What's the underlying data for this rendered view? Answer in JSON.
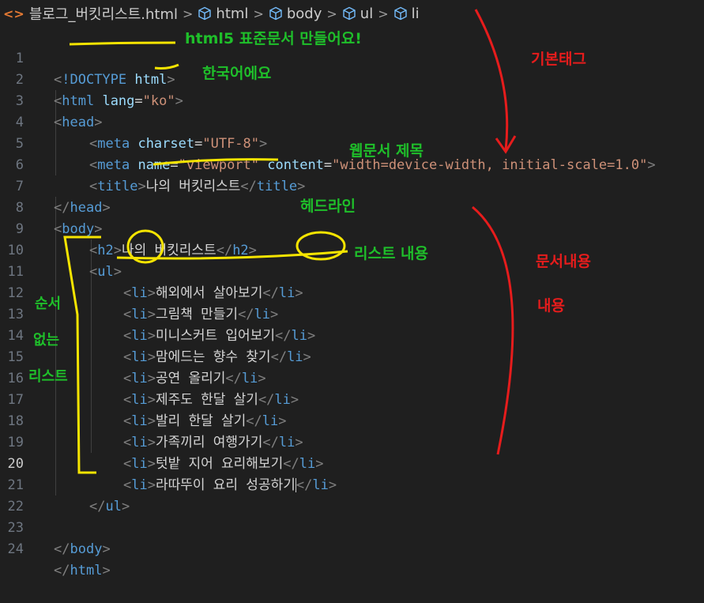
{
  "breadcrumb": {
    "file_icon": "<>",
    "file": "블로그_버킷리스트.html",
    "segments": [
      "html",
      "body",
      "ul",
      "li"
    ],
    "separator": ">"
  },
  "lines": [
    {
      "n": "1"
    },
    {
      "n": "2"
    },
    {
      "n": "3"
    },
    {
      "n": "4"
    },
    {
      "n": "5"
    },
    {
      "n": "6"
    },
    {
      "n": "7"
    },
    {
      "n": "8"
    },
    {
      "n": "9"
    },
    {
      "n": "10"
    },
    {
      "n": "11"
    },
    {
      "n": "12"
    },
    {
      "n": "13"
    },
    {
      "n": "14"
    },
    {
      "n": "15"
    },
    {
      "n": "16"
    },
    {
      "n": "17"
    },
    {
      "n": "18"
    },
    {
      "n": "19"
    },
    {
      "n": "20"
    },
    {
      "n": "21"
    },
    {
      "n": "22"
    },
    {
      "n": "23"
    },
    {
      "n": "24"
    }
  ],
  "code": {
    "l1": {
      "lt": "<",
      "doctype": "!DOCTYPE",
      "html": "html",
      "gt": ">"
    },
    "l2": {
      "lt": "<",
      "tag": "html",
      "attr": "lang",
      "eq": "=",
      "val": "\"ko\"",
      "gt": ">"
    },
    "l3": {
      "lt": "<",
      "tag": "head",
      "gt": ">"
    },
    "l4": {
      "lt": "<",
      "tag": "meta",
      "attr": "charset",
      "eq": "=",
      "val": "\"UTF-8\"",
      "gt": ">"
    },
    "l5": {
      "lt": "<",
      "tag": "meta",
      "attr1": "name",
      "eq": "=",
      "val1": "\"viewport\"",
      "attr2": "content",
      "val2": "\"width=device-width, initial-scale=1.0\"",
      "gt": ">"
    },
    "l6": {
      "open": "<",
      "tag": "title",
      "gt": ">",
      "text": "나의 버킷리스트",
      "close": "</",
      "tag2": "title"
    },
    "l7": {
      "close": "</",
      "tag": "head",
      "gt": ">"
    },
    "l8": {
      "lt": "<",
      "tag": "body",
      "gt": ">"
    },
    "l9": {
      "open": "<",
      "tag": "h2",
      "gt": ">",
      "text": "나의 버킷리스트",
      "close": "</",
      "tag2": "h2"
    },
    "l10": {
      "lt": "<",
      "tag": "ul",
      "gt": ">"
    },
    "li_items": [
      "해외에서 살아보기",
      "그림책 만들기",
      "미니스커트 입어보기",
      "맘에드는 향수 찾기",
      "공연 올리기",
      "제주도 한달 살기",
      "발리 한달 살기",
      "가족끼리 여행가기",
      "텃밭 지어 요리해보기",
      "라따뚜이 요리 성공하기"
    ],
    "li_tag": "li",
    "l21": {
      "close": "</",
      "tag": "ul",
      "gt": ">"
    },
    "l23": {
      "close": "</",
      "tag": "body",
      "gt": ">"
    },
    "l24": {
      "close": "</",
      "tag": "html",
      "gt": ">"
    }
  },
  "annotations": {
    "a1": "html5 표준문서 만들어요!",
    "a2": "한국어에요",
    "a3": "웹문서 제목",
    "a4": "헤드라인",
    "a5": "리스트 내용",
    "a6": "기본태그",
    "a7": "문서내용",
    "a8": "내용",
    "a9": "순서",
    "a10": "없는",
    "a11": "리스트"
  },
  "colors": {
    "background": "#1f1f1f",
    "tag": "#569cd6",
    "attr": "#9cdcfe",
    "string": "#ce9178",
    "punct": "#808080",
    "text": "#d4d4d4",
    "annotation_green": "#1fbf2a",
    "annotation_yellow": "#f5e400",
    "annotation_red": "#e61c1c"
  },
  "active_line": "20"
}
